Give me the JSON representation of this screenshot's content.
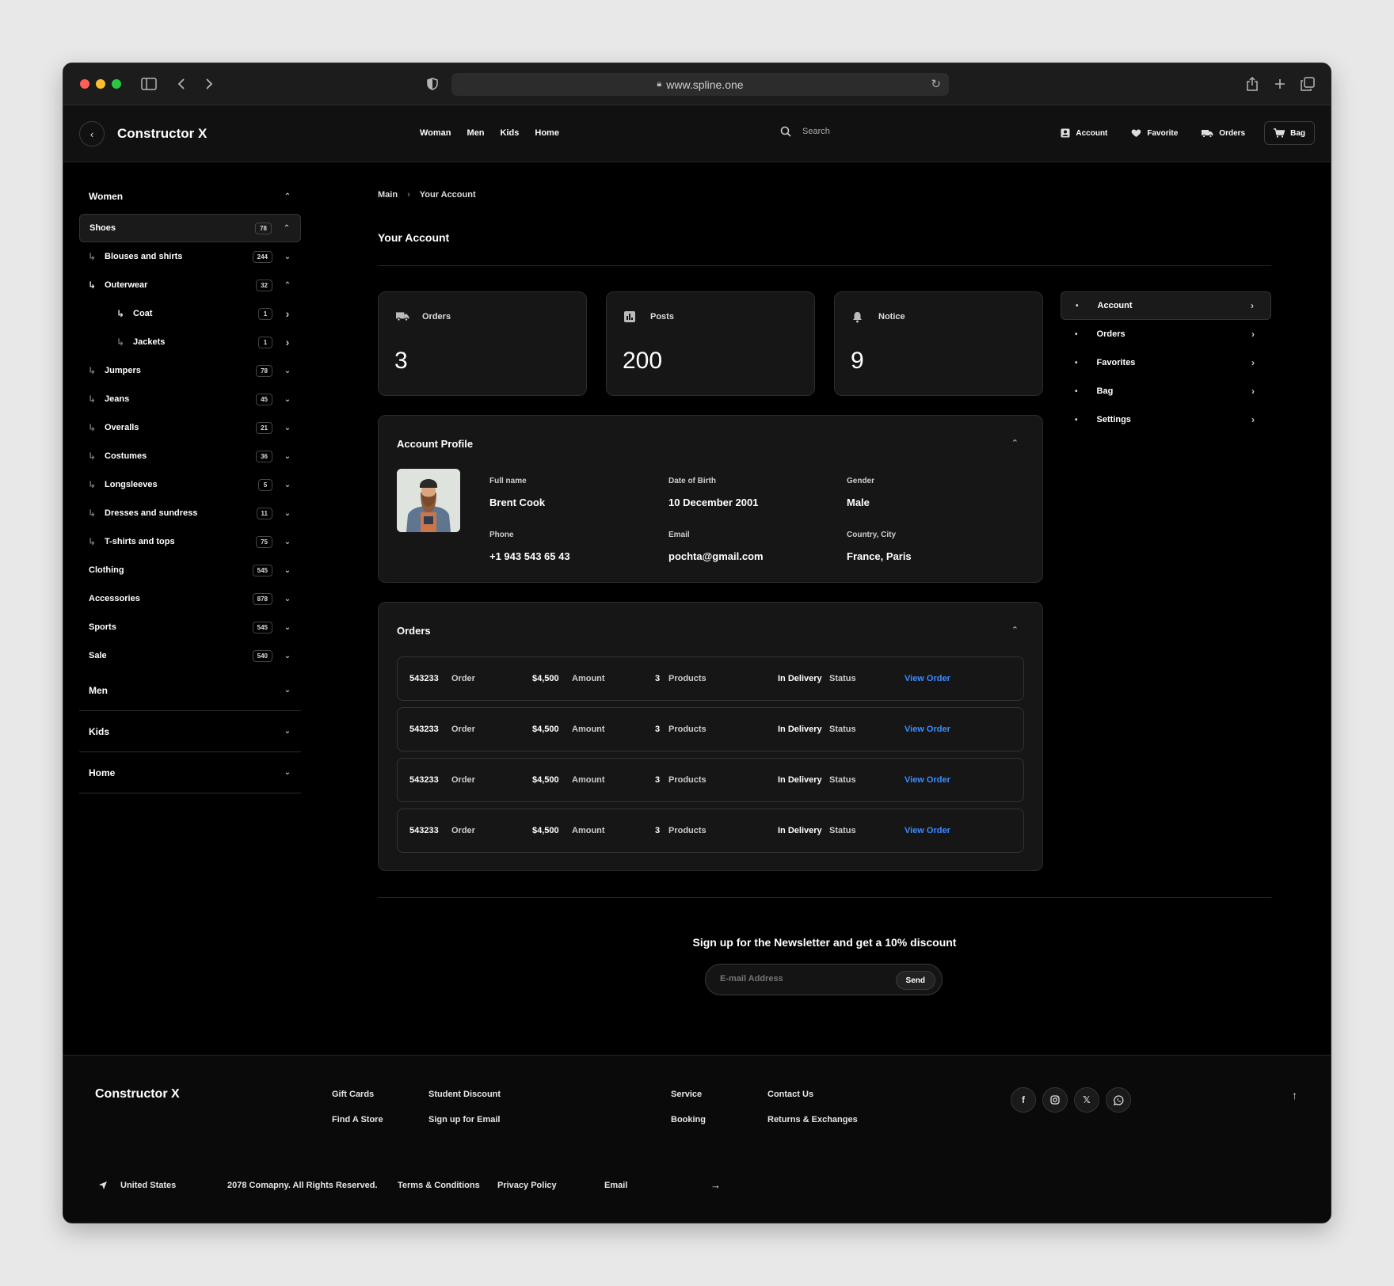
{
  "browser": {
    "url": "www.spline.one",
    "dots": [
      "#ff5f57",
      "#febc2e",
      "#28c840"
    ]
  },
  "header": {
    "brand": "Constructor X",
    "nav": [
      "Woman",
      "Men",
      "Kids",
      "Home"
    ],
    "search_placeholder": "Search",
    "actions": {
      "account": "Account",
      "favorite": "Favorite",
      "orders": "Orders",
      "bag": "Bag"
    }
  },
  "sidebar": {
    "women": "Women",
    "rows": [
      {
        "label": "Shoes",
        "count": "78",
        "level": 0,
        "active": true,
        "open": true
      },
      {
        "label": "Blouses and shirts",
        "count": "244",
        "level": 1
      },
      {
        "label": "Outerwear",
        "count": "32",
        "level": 1,
        "open": true,
        "bright": true
      },
      {
        "label": "Coat",
        "count": "1",
        "level": 2,
        "side": true,
        "bright": true
      },
      {
        "label": "Jackets",
        "count": "1",
        "level": 2,
        "side": true
      },
      {
        "label": "Jumpers",
        "count": "78",
        "level": 1
      },
      {
        "label": "Jeans",
        "count": "45",
        "level": 1
      },
      {
        "label": "Overalls",
        "count": "21",
        "level": 1
      },
      {
        "label": "Costumes",
        "count": "36",
        "level": 1
      },
      {
        "label": "Longsleeves",
        "count": "5",
        "level": 1
      },
      {
        "label": "Dresses and sundress",
        "count": "11",
        "level": 1
      },
      {
        "label": "T-shirts and tops",
        "count": "75",
        "level": 1
      },
      {
        "label": "Clothing",
        "count": "545",
        "level": 0
      },
      {
        "label": "Accessories",
        "count": "878",
        "level": 0
      },
      {
        "label": "Sports",
        "count": "545",
        "level": 0
      },
      {
        "label": "Sale",
        "count": "540",
        "level": 0
      }
    ],
    "sections": [
      "Men",
      "Kids",
      "Home"
    ]
  },
  "breadcrumb": {
    "main": "Main",
    "current": "Your Account"
  },
  "page_title": "Your Account",
  "stats": [
    {
      "label": "Orders",
      "value": "3",
      "icon": "truck-icon"
    },
    {
      "label": "Posts",
      "value": "200",
      "icon": "chart-icon"
    },
    {
      "label": "Notice",
      "value": "9",
      "icon": "bell-icon"
    }
  ],
  "profile": {
    "title": "Account Profile",
    "fields": [
      {
        "key": "Full name",
        "value": "Brent Cook"
      },
      {
        "key": "Date of Birth",
        "value": "10 December 2001"
      },
      {
        "key": "Gender",
        "value": "Male"
      },
      {
        "key": "Phone",
        "value": "+1 943 543 65 43"
      },
      {
        "key": "Email",
        "value": "pochta@gmail.com"
      },
      {
        "key": "Country, City",
        "value": "France, Paris"
      }
    ]
  },
  "orders": {
    "title": "Orders",
    "rows": [
      {
        "id": "543233",
        "id_label": "Order",
        "amount": "$4,500",
        "amount_label": "Amount",
        "products": "3",
        "products_label": "Products",
        "status": "In Delivery",
        "status_label": "Status",
        "link": "View Order"
      },
      {
        "id": "543233",
        "id_label": "Order",
        "amount": "$4,500",
        "amount_label": "Amount",
        "products": "3",
        "products_label": "Products",
        "status": "In Delivery",
        "status_label": "Status",
        "link": "View Order"
      },
      {
        "id": "543233",
        "id_label": "Order",
        "amount": "$4,500",
        "amount_label": "Amount",
        "products": "3",
        "products_label": "Products",
        "status": "In Delivery",
        "status_label": "Status",
        "link": "View Order"
      },
      {
        "id": "543233",
        "id_label": "Order",
        "amount": "$4,500",
        "amount_label": "Amount",
        "products": "3",
        "products_label": "Products",
        "status": "In Delivery",
        "status_label": "Status",
        "link": "View Order"
      }
    ]
  },
  "right_menu": [
    "Account",
    "Orders",
    "Favorites",
    "Bag",
    "Settings"
  ],
  "newsletter": {
    "title": "Sign up for the Newsletter and get a 10% discount",
    "placeholder": "E-mail Address",
    "send": "Send"
  },
  "footer": {
    "brand": "Constructor X",
    "links": [
      "Gift Cards",
      "Student Discount",
      "Find A Store",
      "Sign up for Email",
      "Service",
      "Contact Us",
      "Booking",
      "Returns & Exchanges"
    ],
    "social": [
      "facebook-icon",
      "instagram-icon",
      "x-icon",
      "whatsapp-icon"
    ],
    "country": "United States",
    "copyright": "2078 Comapny. All Rights Reserved.",
    "terms": "Terms & Conditions",
    "privacy": "Privacy Policy",
    "email": "Email"
  },
  "colors": {
    "accent_link": "#3c8cff",
    "background": "#000000",
    "card": "#161616"
  }
}
